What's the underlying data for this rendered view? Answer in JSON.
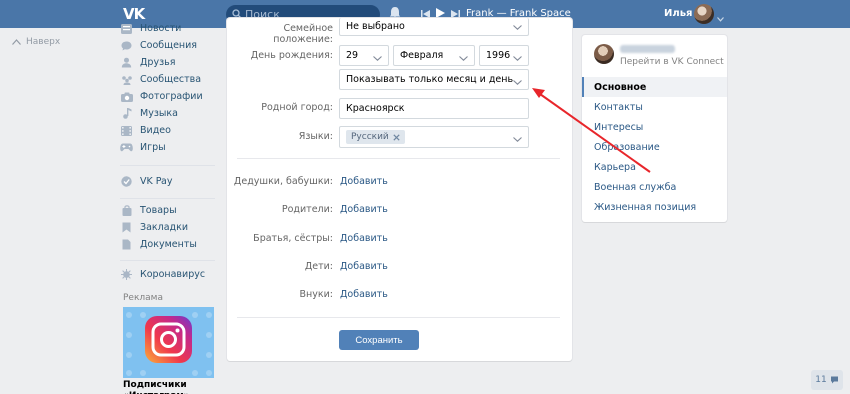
{
  "header": {
    "logo": "VK",
    "search_placeholder": "Поиск",
    "track": "Frank — Frank Space",
    "user_name": "Илья"
  },
  "back_top": "Наверх",
  "menu": {
    "items": [
      {
        "label": "Новости",
        "icon": "newspaper-icon"
      },
      {
        "label": "Сообщения",
        "icon": "messages-icon"
      },
      {
        "label": "Друзья",
        "icon": "friends-icon"
      },
      {
        "label": "Сообщества",
        "icon": "communities-icon"
      },
      {
        "label": "Фотографии",
        "icon": "camera-icon"
      },
      {
        "label": "Музыка",
        "icon": "music-note-icon"
      },
      {
        "label": "Видео",
        "icon": "video-icon"
      },
      {
        "label": "Игры",
        "icon": "gamepad-icon"
      },
      {
        "label": "VK Pay",
        "icon": "vkpay-icon"
      },
      {
        "label": "Товары",
        "icon": "shopping-bag-icon"
      },
      {
        "label": "Закладки",
        "icon": "bookmark-icon"
      },
      {
        "label": "Документы",
        "icon": "document-icon"
      },
      {
        "label": "Коронавирус",
        "icon": "virus-icon"
      }
    ],
    "ad_label": "Реклама",
    "ad_caption": "Подписчики\n«Инстаграм»"
  },
  "form": {
    "family_label": "Семейное положение:",
    "family_value": "Не выбрано",
    "birthday_label": "День рождения:",
    "birthday_day": "29",
    "birthday_month": "Февраля",
    "birthday_year": "1996",
    "birthday_visibility": "Показывать только месяц и день",
    "hometown_label": "Родной город:",
    "hometown_value": "Красноярск",
    "languages_label": "Языки:",
    "language_tag": "Русский",
    "relatives": [
      {
        "label": "Дедушки, бабушки:",
        "action": "Добавить"
      },
      {
        "label": "Родители:",
        "action": "Добавить"
      },
      {
        "label": "Братья, сёстры:",
        "action": "Добавить"
      },
      {
        "label": "Дети:",
        "action": "Добавить"
      },
      {
        "label": "Внуки:",
        "action": "Добавить"
      }
    ],
    "save_label": "Сохранить"
  },
  "right_nav": {
    "connect_label": "Перейти в VK Connect",
    "items": [
      "Основное",
      "Контакты",
      "Интересы",
      "Образование",
      "Карьера",
      "Военная служба",
      "Жизненная позиция"
    ],
    "active_index": 0
  },
  "counter": "11",
  "colors": {
    "header_blue": "#4a76a8",
    "link_blue": "#2a5885",
    "button_blue": "#5181b8",
    "arrow_red": "#e8262b",
    "page_bg": "#edeef0"
  }
}
